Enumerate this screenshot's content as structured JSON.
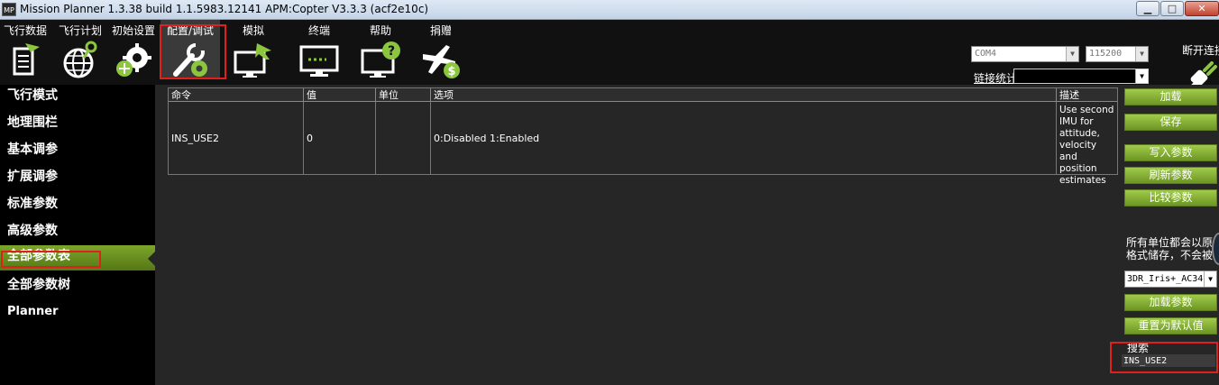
{
  "window": {
    "icon_text": "MP",
    "title": "Mission Planner 1.3.38 build 1.1.5983.12141 APM:Copter V3.3.3 (acf2e10c)",
    "min_glyph": "▁",
    "max_glyph": "□",
    "close_glyph": "✕"
  },
  "toolbar": {
    "items": [
      {
        "label": "飞行数据",
        "icon": "flight-data-icon"
      },
      {
        "label": "飞行计划",
        "icon": "flight-plan-icon"
      },
      {
        "label": "初始设置",
        "icon": "initial-setup-icon"
      },
      {
        "label": "配置/调试",
        "icon": "config-tuning-icon"
      },
      {
        "label": "模拟",
        "icon": "simulation-icon"
      },
      {
        "label": "终端",
        "icon": "terminal-icon"
      },
      {
        "label": "帮助",
        "icon": "help-icon"
      },
      {
        "label": "捐赠",
        "icon": "donate-icon"
      }
    ],
    "port": "COM4",
    "baud": "115200",
    "stats_label": "链接统计",
    "connect_label": "断开连接",
    "accent": "#8cc63f",
    "highlight": "#e0201c"
  },
  "nav": {
    "items": [
      "飞行模式",
      "地理围栏",
      "基本调参",
      "扩展调参",
      "标准参数",
      "高级参数",
      "全部参数表",
      "全部参数树",
      "Planner"
    ],
    "selected": "全部参数表"
  },
  "grid": {
    "headers": [
      "命令",
      "值",
      "单位",
      "选项",
      "描述"
    ],
    "rows": [
      {
        "command": "INS_USE2",
        "value": "0",
        "unit": "",
        "options": "0:Disabled 1:Enabled",
        "desc": "Use second IMU for attitude, velocity and position estimates"
      }
    ]
  },
  "right": {
    "load": "加载",
    "save": "保存",
    "write": "写入参数",
    "refresh": "刷新参数",
    "compare": "比较参数",
    "units_line1": "所有单位都会以原",
    "units_line2": "格式储存，不会被",
    "preset": "3DR_Iris+_AC34",
    "load_params": "加载参数",
    "reset_default": "重置为默认值",
    "search_label": "搜索",
    "search_value": "INS_USE2"
  }
}
